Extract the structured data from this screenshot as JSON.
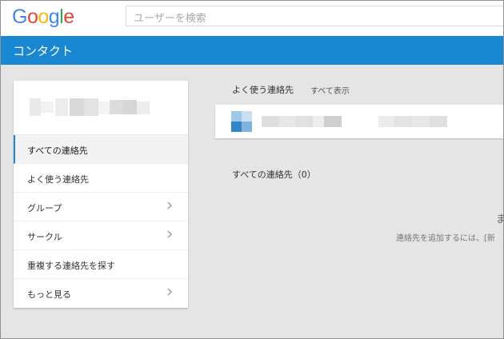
{
  "logo": {
    "letters": [
      "G",
      "o",
      "o",
      "g",
      "l",
      "e"
    ],
    "colors": [
      "#4285f4",
      "#ea4335",
      "#fbbc05",
      "#4285f4",
      "#34a853",
      "#ea4335"
    ]
  },
  "search": {
    "placeholder": "ユーザーを検索"
  },
  "header": {
    "title": "コンタクト"
  },
  "colors": {
    "accent": "#1a87d3",
    "background": "#e5e5e5"
  },
  "sidebar": {
    "items": [
      {
        "label": "すべての連絡先",
        "active": true,
        "chevron": false
      },
      {
        "label": "よく使う連絡先",
        "active": false,
        "chevron": false
      },
      {
        "label": "グループ",
        "active": false,
        "chevron": true
      },
      {
        "label": "サークル",
        "active": false,
        "chevron": true
      },
      {
        "label": "重複する連絡先を探す",
        "active": false,
        "chevron": false
      },
      {
        "label": "もっと見る",
        "active": false,
        "chevron": true
      }
    ]
  },
  "favorites": {
    "label": "よく使う連絡先",
    "show_all": "すべて表示"
  },
  "all_contacts": {
    "label": "すべての連絡先（0）"
  },
  "empty_state": {
    "title": "ま",
    "text": "連絡先を追加するには、[新"
  }
}
